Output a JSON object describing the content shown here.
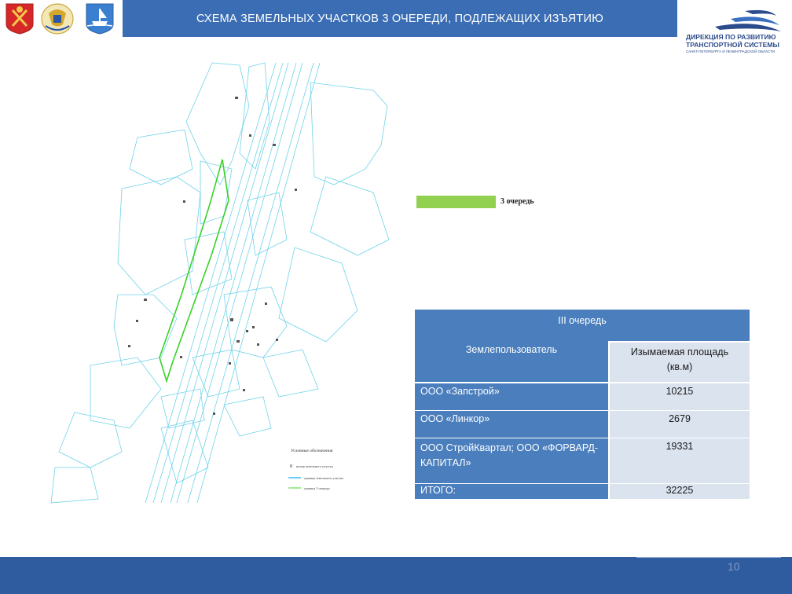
{
  "header": {
    "title": "СХЕМА ЗЕМЕЛЬНЫХ УЧАСТКОВ 3 ОЧЕРЕДИ, ПОДЛЕЖАЩИХ ИЗЪЯТИЮ"
  },
  "logo": {
    "line1": "ДИРЕКЦИЯ ПО РАЗВИТИЮ",
    "line2": "ТРАНСПОРТНОЙ СИСТЕМЫ",
    "line3": "САНКТ-ПЕТЕРБУРГА И ЛЕНИНГРАДСКОЙ ОБЛАСТИ"
  },
  "map_legend": {
    "swatch_color": "#92d050",
    "label": "3 очередь"
  },
  "map_key": {
    "title": "Условные обозначения",
    "items": [
      {
        "symbol": "8",
        "text": "номер земельного участка"
      },
      {
        "text": "граница земельного участка",
        "color": "#00b0f0"
      },
      {
        "text": "граница 3 очереди",
        "color": "#66e04f"
      }
    ]
  },
  "table": {
    "title": "III очередь",
    "col1_header": "Землепользователь",
    "col2_header": "Изымаемая площадь (кв.м)",
    "rows": [
      {
        "owner": "ООО «Запстрой»",
        "area": "10215"
      },
      {
        "owner": "ООО «Линкор»",
        "area": "2679"
      },
      {
        "owner": "ООО СтройКвартал; ООО «ФОРВАРД-КАПИТАЛ»",
        "area": "19331"
      }
    ],
    "total_label": "ИТОГО:",
    "total_value": "32225"
  },
  "footer": {
    "page_number": "10"
  },
  "colors": {
    "header_blue": "#3a6db3",
    "footer_blue": "#2f5c9f",
    "table_blue": "#4a7ebd",
    "table_light": "#dbe3ef"
  }
}
